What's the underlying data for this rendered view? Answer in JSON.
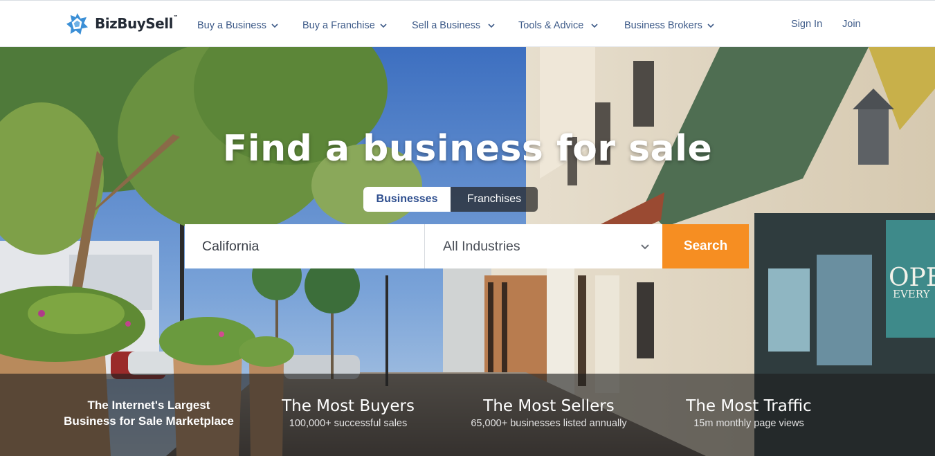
{
  "header": {
    "logo_text": "BizBuySell",
    "logo_tm": "™",
    "logo_icon": "bizbuysell-star-icon",
    "nav": [
      {
        "label": "Buy a Business",
        "icon": "chevron-down-icon"
      },
      {
        "label": "Buy a Franchise",
        "icon": "chevron-down-icon"
      },
      {
        "label": "Sell a Business",
        "icon": "chevron-down-icon"
      },
      {
        "label": "Tools & Advice",
        "icon": "chevron-down-icon"
      },
      {
        "label": "Business Brokers",
        "icon": "chevron-down-icon"
      }
    ],
    "sign_in": "Sign In",
    "join": "Join"
  },
  "hero": {
    "title": "Find a business for sale",
    "toggle": {
      "active": "Businesses",
      "inactive": "Franchises"
    },
    "search": {
      "location_value": "California",
      "industry_value": "All Industries",
      "button_label": "Search"
    },
    "stats": {
      "tagline_line1": "The Internet's Largest",
      "tagline_line2": "Business for Sale Marketplace",
      "items": [
        {
          "title": "The Most Buyers",
          "sub": "100,000+ successful sales"
        },
        {
          "title": "The Most Sellers",
          "sub": "65,000+ businesses listed annually"
        },
        {
          "title": "The Most Traffic",
          "sub": "15m monthly page views"
        }
      ]
    },
    "storefront_sign": {
      "line1": "OPE",
      "line2": "EVERY"
    }
  },
  "colors": {
    "nav_text": "#3d5a88",
    "search_button": "#f68e22",
    "logo_blue": "#3b8fd6",
    "toggle_active_text": "#2f4f8f"
  }
}
